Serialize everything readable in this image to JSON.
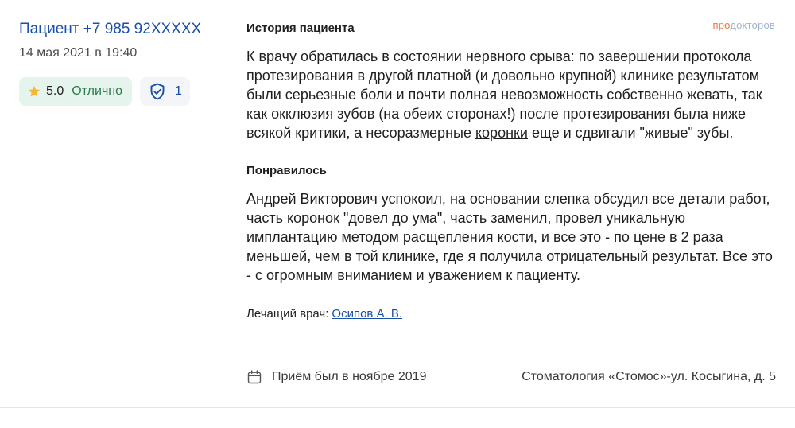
{
  "author": {
    "name": "Пациент +7 985 92XXXXX",
    "date": "14 мая 2021 в 19:40"
  },
  "rating": {
    "value": "5.0",
    "label": "Отлично",
    "icon": "star-icon",
    "color": "#f5b836",
    "badge_bg": "#e5f4ec"
  },
  "verification": {
    "count": "1",
    "icon": "shield-check-icon"
  },
  "brand": {
    "part1": "про",
    "part2": "докторов"
  },
  "history": {
    "title": "История пациента",
    "text_before": "К врачу обратилась в состоянии нервного срыва: по завершении протокола протезирования в другой платной (и довольно крупной) клинике результатом были серьезные боли и почти полная невозможность собственно жевать, так как окклюзия зубов (на обеих сторонах!) после протезирования была ниже всякой критики, а несоразмерные ",
    "link_word": "коронки",
    "text_after": " еще и сдвигали \"живые\" зубы."
  },
  "liked": {
    "title": "Понравилось",
    "text": "Андрей Викторович успокоил, на основании слепка обсудил все детали работ, часть коронок \"довел до ума\", часть заменил, провел уникальную имплантацию методом расщепления кости, и все это - по цене в 2 раза меньшей, чем в той клинике, где я получила отрицательный результат. Все это - с огромным вниманием и уважением к пациенту."
  },
  "doctor": {
    "label": "Лечащий врач:",
    "name": "Осипов А. В."
  },
  "visit": {
    "text": "Приём был в ноябре 2019",
    "icon": "calendar-icon"
  },
  "clinic": {
    "text": "Стоматология «Стомос»-ул. Косыгина, д. 5"
  },
  "colors": {
    "link": "#1a4fa8",
    "brand_pro": "#f0743e",
    "brand_rest": "#9fb3cf"
  }
}
